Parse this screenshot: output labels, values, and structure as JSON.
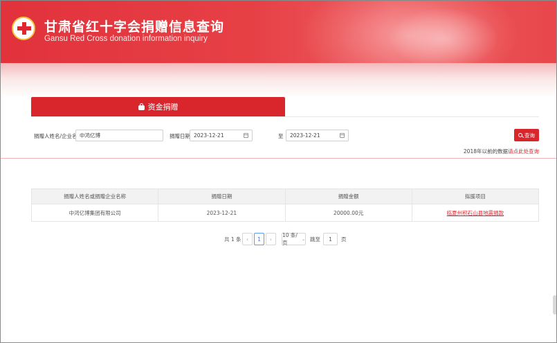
{
  "header": {
    "title_cn": "甘肃省红十字会捐赠信息查询",
    "title_en": "Gansu Red Cross donation information inquiry",
    "logo_icon": "red-cross-logo-icon"
  },
  "tabs": [
    {
      "label": "资金捐赠",
      "icon": "money-bag-icon",
      "active": true
    }
  ],
  "search": {
    "donor_label": "捐赠人姓名/企业名称",
    "donor_value": "中鸿亿博",
    "date_label": "捐赠日期",
    "date_from": "2023-12-21",
    "to_label": "至",
    "date_to": "2023-12-21",
    "button_label": "查询"
  },
  "hint": {
    "prefix": "2018年以前的数据",
    "link": "请点此处查询"
  },
  "table": {
    "columns": [
      "捐赠人姓名或捐赠企业名称",
      "捐赠日期",
      "捐赠金额",
      "拟援项目"
    ],
    "rows": [
      [
        "中鸿亿博集团有限公司",
        "2023-12-21",
        "20000.00元",
        "临夏州积石山县地震捐款"
      ]
    ]
  },
  "pagination": {
    "total": "共 1 条",
    "prev": "‹",
    "page": "1",
    "next": "›",
    "page_size": "10 条/页",
    "goto_label": "跳至",
    "goto_value": "1",
    "page_unit": "页"
  },
  "colors": {
    "brand_red": "#d9262d",
    "active_blue": "#3c7fd0"
  }
}
